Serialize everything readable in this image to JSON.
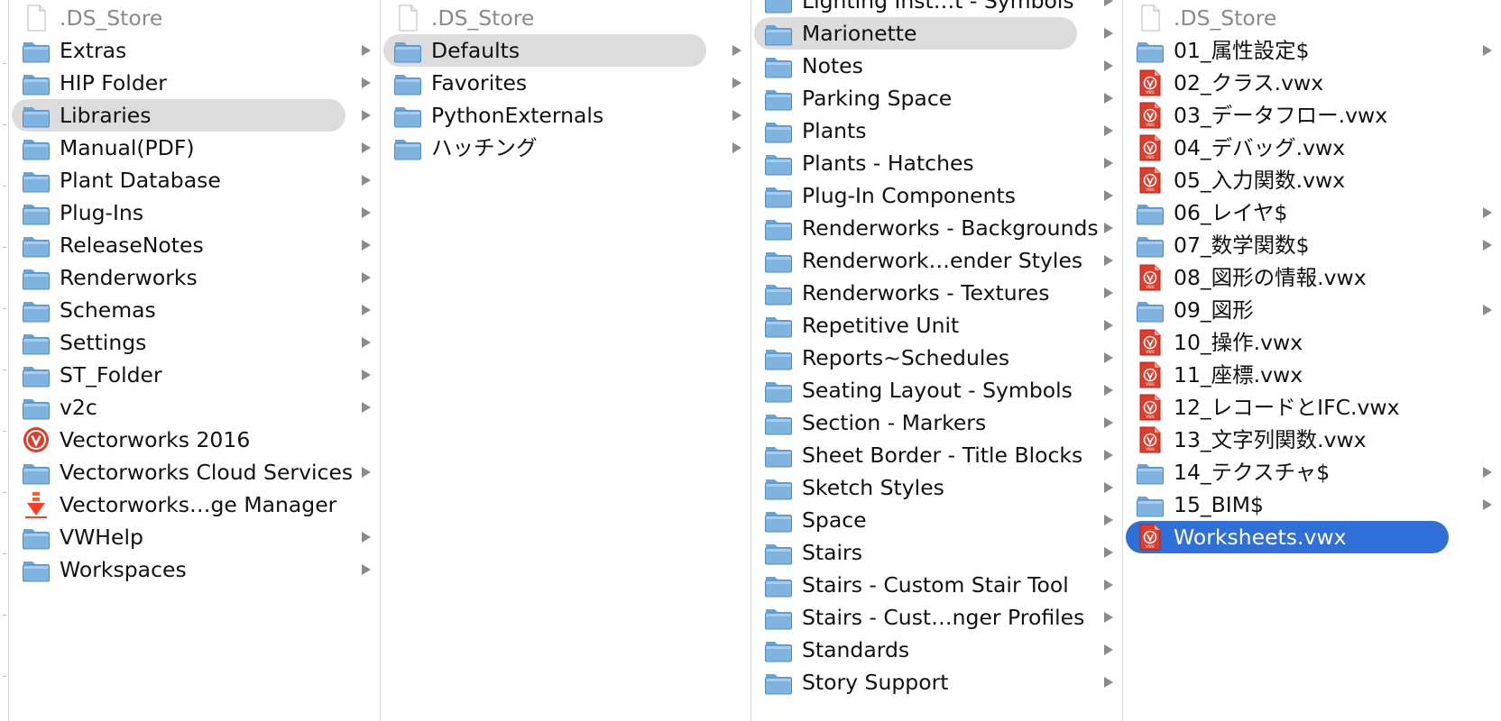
{
  "colors": {
    "selection_active": "#2f6fd8",
    "selection_inactive": "#dcdcdc",
    "folder": "#7fb4e0",
    "vwx_red": "#e23b2a"
  },
  "columns": [
    {
      "items": [
        {
          "label": ".DS_Store",
          "type": "doc",
          "arrow": false,
          "dim": true
        },
        {
          "label": "Extras",
          "type": "folder",
          "arrow": true
        },
        {
          "label": "HIP Folder",
          "type": "folder",
          "arrow": true
        },
        {
          "label": "Libraries",
          "type": "folder",
          "arrow": true,
          "highlight": "inactive"
        },
        {
          "label": "Manual(PDF)",
          "type": "folder",
          "arrow": true
        },
        {
          "label": "Plant Database",
          "type": "folder",
          "arrow": true
        },
        {
          "label": "Plug-Ins",
          "type": "folder",
          "arrow": true
        },
        {
          "label": "ReleaseNotes",
          "type": "folder",
          "arrow": true
        },
        {
          "label": "Renderworks",
          "type": "folder",
          "arrow": true
        },
        {
          "label": "Schemas",
          "type": "folder",
          "arrow": true
        },
        {
          "label": "Settings",
          "type": "folder",
          "arrow": true
        },
        {
          "label": "ST_Folder",
          "type": "folder",
          "arrow": true
        },
        {
          "label": "v2c",
          "type": "folder",
          "arrow": true
        },
        {
          "label": "Vectorworks 2016",
          "type": "app",
          "arrow": false
        },
        {
          "label": "Vectorworks Cloud Services",
          "type": "folder",
          "arrow": true
        },
        {
          "label": "Vectorworks…ge Manager",
          "type": "download",
          "arrow": false
        },
        {
          "label": "VWHelp",
          "type": "folder",
          "arrow": true
        },
        {
          "label": "Workspaces",
          "type": "folder",
          "arrow": true
        }
      ]
    },
    {
      "items": [
        {
          "label": ".DS_Store",
          "type": "doc",
          "arrow": false,
          "dim": true
        },
        {
          "label": "Defaults",
          "type": "folder",
          "arrow": true,
          "highlight": "inactive"
        },
        {
          "label": "Favorites",
          "type": "folder",
          "arrow": true
        },
        {
          "label": "PythonExternals",
          "type": "folder",
          "arrow": true
        },
        {
          "label": "ハッチング",
          "type": "folder",
          "arrow": true
        }
      ]
    },
    {
      "items": [
        {
          "label": "Lighting Inst…t - Symbols",
          "type": "folder",
          "arrow": true
        },
        {
          "label": "Marionette",
          "type": "folder",
          "arrow": true,
          "highlight": "inactive"
        },
        {
          "label": "Notes",
          "type": "folder",
          "arrow": true
        },
        {
          "label": "Parking Space",
          "type": "folder",
          "arrow": true
        },
        {
          "label": "Plants",
          "type": "folder",
          "arrow": true
        },
        {
          "label": "Plants - Hatches",
          "type": "folder",
          "arrow": true
        },
        {
          "label": "Plug-In Components",
          "type": "folder",
          "arrow": true
        },
        {
          "label": "Renderworks - Backgrounds",
          "type": "folder",
          "arrow": true
        },
        {
          "label": "Renderwork…ender Styles",
          "type": "folder",
          "arrow": true
        },
        {
          "label": "Renderworks - Textures",
          "type": "folder",
          "arrow": true
        },
        {
          "label": "Repetitive Unit",
          "type": "folder",
          "arrow": true
        },
        {
          "label": "Reports~Schedules",
          "type": "folder",
          "arrow": true
        },
        {
          "label": "Seating Layout - Symbols",
          "type": "folder",
          "arrow": true
        },
        {
          "label": "Section - Markers",
          "type": "folder",
          "arrow": true
        },
        {
          "label": "Sheet Border - Title Blocks",
          "type": "folder",
          "arrow": true
        },
        {
          "label": "Sketch Styles",
          "type": "folder",
          "arrow": true
        },
        {
          "label": "Space",
          "type": "folder",
          "arrow": true
        },
        {
          "label": "Stairs",
          "type": "folder",
          "arrow": true
        },
        {
          "label": "Stairs - Custom Stair Tool",
          "type": "folder",
          "arrow": true
        },
        {
          "label": "Stairs - Cust…nger Profiles",
          "type": "folder",
          "arrow": true
        },
        {
          "label": "Standards",
          "type": "folder",
          "arrow": true
        },
        {
          "label": "Story Support",
          "type": "folder",
          "arrow": true
        }
      ]
    },
    {
      "items": [
        {
          "label": ".DS_Store",
          "type": "doc",
          "arrow": false,
          "dim": true
        },
        {
          "label": "01_属性設定$",
          "type": "folder",
          "arrow": true
        },
        {
          "label": "02_クラス.vwx",
          "type": "vwx",
          "arrow": false
        },
        {
          "label": "03_データフロー.vwx",
          "type": "vwx",
          "arrow": false
        },
        {
          "label": "04_デバッグ.vwx",
          "type": "vwx",
          "arrow": false
        },
        {
          "label": "05_入力関数.vwx",
          "type": "vwx",
          "arrow": false
        },
        {
          "label": "06_レイヤ$",
          "type": "folder",
          "arrow": true
        },
        {
          "label": "07_数学関数$",
          "type": "folder",
          "arrow": true
        },
        {
          "label": "08_図形の情報.vwx",
          "type": "vwx",
          "arrow": false
        },
        {
          "label": "09_図形",
          "type": "folder",
          "arrow": true
        },
        {
          "label": "10_操作.vwx",
          "type": "vwx",
          "arrow": false
        },
        {
          "label": "11_座標.vwx",
          "type": "vwx",
          "arrow": false
        },
        {
          "label": "12_レコードとIFC.vwx",
          "type": "vwx",
          "arrow": false
        },
        {
          "label": "13_文字列関数.vwx",
          "type": "vwx",
          "arrow": false
        },
        {
          "label": "14_テクスチャ$",
          "type": "folder",
          "arrow": true
        },
        {
          "label": "15_BIM$",
          "type": "folder",
          "arrow": true
        },
        {
          "label": "Worksheets.vwx",
          "type": "vwx",
          "arrow": false,
          "highlight": "active"
        }
      ]
    }
  ]
}
